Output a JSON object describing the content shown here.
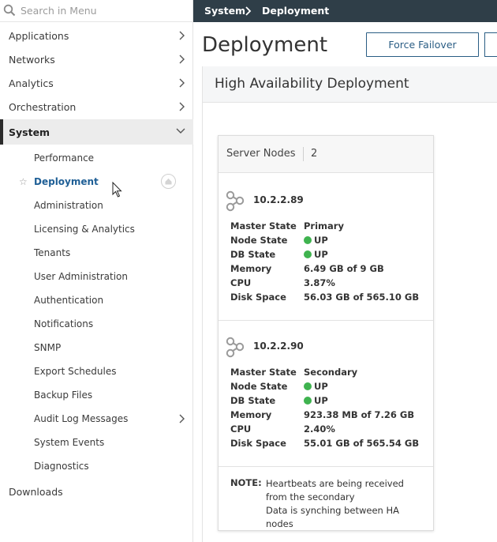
{
  "search": {
    "placeholder": "Search in Menu"
  },
  "nav": [
    {
      "label": "Applications"
    },
    {
      "label": "Networks"
    },
    {
      "label": "Analytics"
    },
    {
      "label": "Orchestration"
    },
    {
      "label": "System"
    }
  ],
  "system_sub": [
    {
      "label": "Performance"
    },
    {
      "label": "Deployment"
    },
    {
      "label": "Administration"
    },
    {
      "label": "Licensing & Analytics"
    },
    {
      "label": "Tenants"
    },
    {
      "label": "User Administration"
    },
    {
      "label": "Authentication"
    },
    {
      "label": "Notifications"
    },
    {
      "label": "SNMP"
    },
    {
      "label": "Export Schedules"
    },
    {
      "label": "Backup Files"
    },
    {
      "label": "Audit Log Messages"
    },
    {
      "label": "System Events"
    },
    {
      "label": "Diagnostics"
    }
  ],
  "downloads": {
    "label": "Downloads"
  },
  "breadcrumb": {
    "root": "System",
    "current": "Deployment"
  },
  "page": {
    "title": "Deployment",
    "force_failover_label": "Force Failover",
    "section_title": "High Availability Deployment"
  },
  "card": {
    "title": "Server Nodes",
    "count": "2",
    "nodes": [
      {
        "ip": "10.2.2.89",
        "master_state_label": "Master State",
        "master_state": "Primary",
        "node_state_label": "Node State",
        "node_state": "UP",
        "db_state_label": "DB State",
        "db_state": "UP",
        "memory_label": "Memory",
        "memory": "6.49 GB of 9 GB",
        "cpu_label": "CPU",
        "cpu": "3.87%",
        "disk_label": "Disk Space",
        "disk": "56.03 GB of 565.10 GB"
      },
      {
        "ip": "10.2.2.90",
        "master_state_label": "Master State",
        "master_state": "Secondary",
        "node_state_label": "Node State",
        "node_state": "UP",
        "db_state_label": "DB State",
        "db_state": "UP",
        "memory_label": "Memory",
        "memory": "923.38 MB of 7.26 GB",
        "cpu_label": "CPU",
        "cpu": "2.40%",
        "disk_label": "Disk Space",
        "disk": "55.01 GB of 565.54 GB"
      }
    ],
    "note_label": "NOTE:",
    "note_line1": "Heartbeats are being received from the secondary",
    "note_line2": "Data is synching between HA nodes"
  },
  "colors": {
    "topbar": "#2f3e48",
    "accent": "#1f5f96",
    "status_up": "#3fb34f"
  }
}
